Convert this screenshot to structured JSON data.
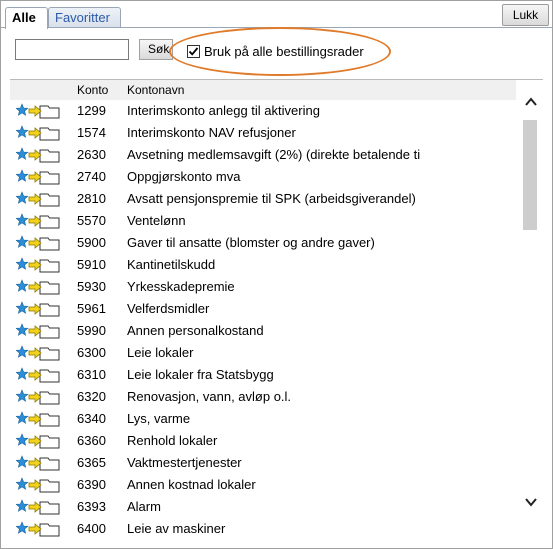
{
  "tabs": {
    "alle": "Alle",
    "favoritter": "Favoritter"
  },
  "close_label": "Lukk",
  "search": {
    "value": "",
    "button_label": "Søk"
  },
  "checkbox": {
    "label": "Bruk på alle bestillingsrader",
    "checked": true
  },
  "columns": {
    "konto": "Konto",
    "kontonavn": "Kontonavn"
  },
  "rows": [
    {
      "konto": "1299",
      "navn": "Interimskonto anlegg til aktivering"
    },
    {
      "konto": "1574",
      "navn": "Interimskonto NAV refusjoner"
    },
    {
      "konto": "2630",
      "navn": "Avsetning medlemsavgift (2%) (direkte betalende ti"
    },
    {
      "konto": "2740",
      "navn": "Oppgjørskonto mva"
    },
    {
      "konto": "2810",
      "navn": "Avsatt pensjonspremie til SPK (arbeidsgiverandel)"
    },
    {
      "konto": "5570",
      "navn": "Ventelønn"
    },
    {
      "konto": "5900",
      "navn": "Gaver til ansatte (blomster og andre gaver)"
    },
    {
      "konto": "5910",
      "navn": "Kantinetilskudd"
    },
    {
      "konto": "5930",
      "navn": "Yrkesskadepremie"
    },
    {
      "konto": "5961",
      "navn": "Velferdsmidler"
    },
    {
      "konto": "5990",
      "navn": "Annen personalkostand"
    },
    {
      "konto": "6300",
      "navn": "Leie lokaler"
    },
    {
      "konto": "6310",
      "navn": "Leie lokaler fra Statsbygg"
    },
    {
      "konto": "6320",
      "navn": "Renovasjon, vann, avløp o.l."
    },
    {
      "konto": "6340",
      "navn": "Lys, varme"
    },
    {
      "konto": "6360",
      "navn": "Renhold lokaler"
    },
    {
      "konto": "6365",
      "navn": "Vaktmestertjenester"
    },
    {
      "konto": "6390",
      "navn": "Annen kostnad lokaler"
    },
    {
      "konto": "6393",
      "navn": "Alarm"
    },
    {
      "konto": "6400",
      "navn": "Leie av maskiner"
    }
  ],
  "icons": {
    "row_star": "star-icon",
    "row_arrow": "arrow-folder-icon"
  },
  "colors": {
    "star": "#2a8fd6",
    "arrow": "#f2d21a",
    "highlight_ring": "#e07b2b"
  }
}
